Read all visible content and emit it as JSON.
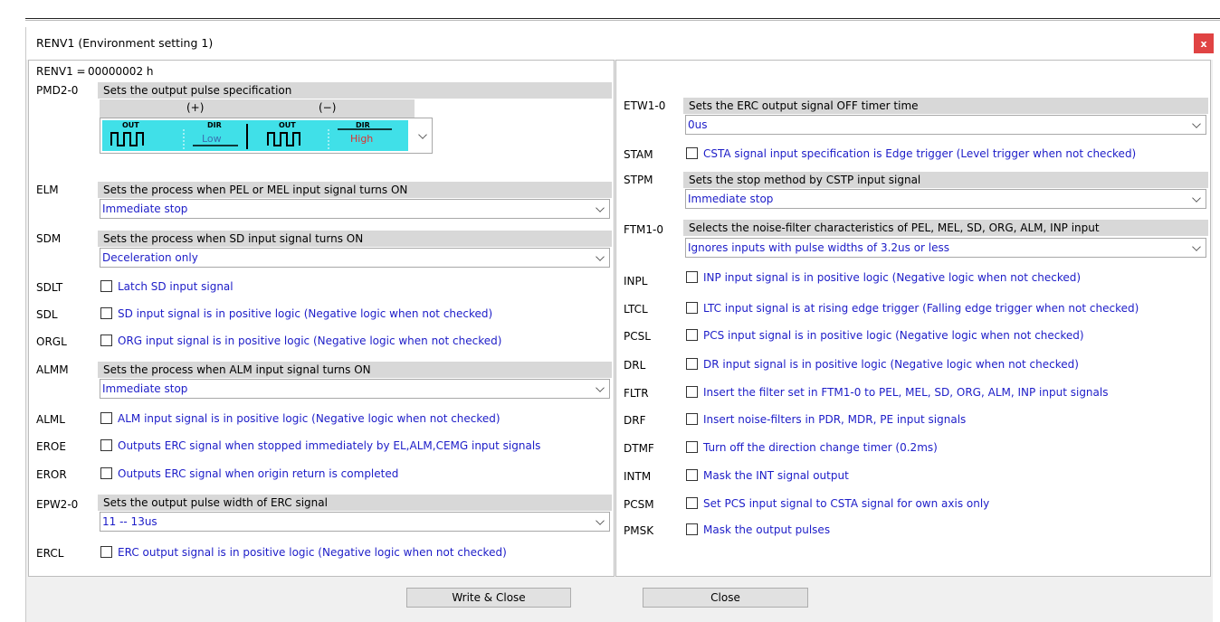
{
  "window": {
    "title": "RENV1 (Environment setting 1)",
    "close_label": "x"
  },
  "register": {
    "label": "RENV1 =",
    "value": "00000002 h"
  },
  "left": {
    "pmd": {
      "code": "PMD2-0",
      "desc": "Sets the output pulse specification",
      "plus": "(+)",
      "minus": "(−)",
      "img": {
        "out1": "OUT",
        "dir1": "DIR",
        "low": "Low",
        "out2": "OUT",
        "dir2": "DIR",
        "high": "High"
      }
    },
    "elm": {
      "code": "ELM",
      "desc": "Sets the process when PEL or MEL input signal turns ON",
      "value": "Immediate stop"
    },
    "sdm": {
      "code": "SDM",
      "desc": "Sets the process when SD input signal turns ON",
      "value": "Deceleration only"
    },
    "sdlt": {
      "code": "SDLT",
      "text": "Latch SD input signal"
    },
    "sdl": {
      "code": "SDL",
      "text": "SD input signal is in positive logic (Negative logic when not checked)"
    },
    "orgl": {
      "code": "ORGL",
      "text": "ORG input signal is in positive logic (Negative logic when not checked)"
    },
    "almm": {
      "code": "ALMM",
      "desc": "Sets the process when ALM input signal turns ON",
      "value": "Immediate stop"
    },
    "alml": {
      "code": "ALML",
      "text": "ALM input signal is in positive logic (Negative logic when not checked)"
    },
    "eroe": {
      "code": "EROE",
      "text": "Outputs ERC signal when stopped immediately by EL,ALM,CEMG input signals"
    },
    "eror": {
      "code": "EROR",
      "text": "Outputs ERC signal when origin return is completed"
    },
    "epw": {
      "code": "EPW2-0",
      "desc": "Sets the output pulse width of ERC signal",
      "value": "11 -- 13us"
    },
    "ercl": {
      "code": "ERCL",
      "text": "ERC output signal is in positive logic (Negative logic when not checked)"
    }
  },
  "right": {
    "etw": {
      "code": "ETW1-0",
      "desc": "Sets the ERC output signal OFF timer time",
      "value": "0us"
    },
    "stam": {
      "code": "STAM",
      "text": "CSTA signal input specification is Edge trigger (Level trigger when not checked)"
    },
    "stpm": {
      "code": "STPM",
      "desc": "Sets the stop method by CSTP input signal",
      "value": "Immediate stop"
    },
    "ftm": {
      "code": "FTM1-0",
      "desc": "Selects the noise-filter characteristics of PEL, MEL, SD, ORG, ALM, INP input",
      "value": "Ignores inputs with pulse widths of 3.2us or less"
    },
    "inpl": {
      "code": "INPL",
      "text": "INP input signal is in positive logic (Negative logic when not checked)"
    },
    "ltcl": {
      "code": "LTCL",
      "text": "LTC input signal is at rising edge trigger (Falling edge trigger when not checked)"
    },
    "pcsl": {
      "code": "PCSL",
      "text": "PCS input signal is in positive logic (Negative logic when not checked)"
    },
    "drl": {
      "code": "DRL",
      "text": "DR input signal is in positive logic (Negative logic when not checked)"
    },
    "fltr": {
      "code": "FLTR",
      "text": "Insert the filter set in FTM1-0 to PEL, MEL, SD, ORG, ALM, INP input signals"
    },
    "drf": {
      "code": "DRF",
      "text": "Insert noise-filters in PDR, MDR, PE input signals"
    },
    "dtmf": {
      "code": "DTMF",
      "text": "Turn off the direction change timer (0.2ms)"
    },
    "intm": {
      "code": "INTM",
      "text": "Mask the INT signal output"
    },
    "pcsm": {
      "code": "PCSM",
      "text": "Set PCS input signal to CSTA signal for own axis only"
    },
    "pmsk": {
      "code": "PMSK",
      "text": "Mask the output pulses"
    }
  },
  "buttons": {
    "write_close": "Write & Close",
    "close": "Close"
  },
  "colors": {
    "value_text": "#1d1dc8",
    "header_bg": "#d8d8d8",
    "pulse_bg": "#40e0e8",
    "close_bg": "#e04343"
  }
}
